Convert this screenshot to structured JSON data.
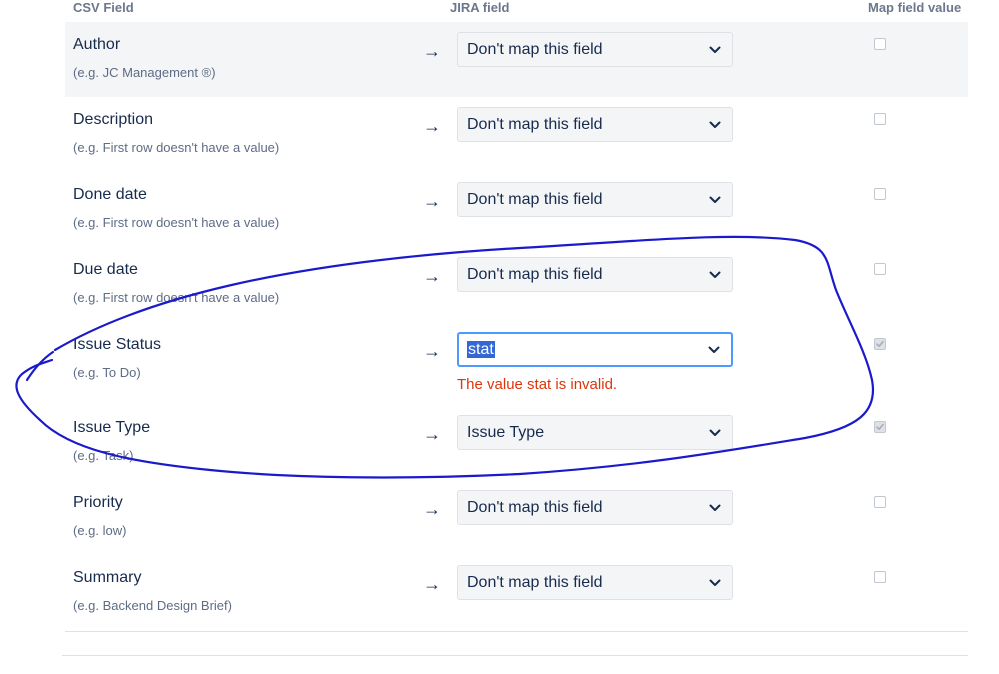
{
  "header": {
    "csv_field": "CSV Field",
    "jira_field": "JIRA field",
    "map_field_value": "Map field value"
  },
  "arrow_symbol": "→",
  "rows": [
    {
      "name": "Author",
      "example": "(e.g. JC Management ®)",
      "mapping": "Don't map this field",
      "map_value_checked": false
    },
    {
      "name": "Description",
      "example": "(e.g. First row doesn't have a value)",
      "mapping": "Don't map this field",
      "map_value_checked": false
    },
    {
      "name": "Done date",
      "example": "(e.g. First row doesn't have a value)",
      "mapping": "Don't map this field",
      "map_value_checked": false
    },
    {
      "name": "Due date",
      "example": "(e.g. First row doesn't have a value)",
      "mapping": "Don't map this field",
      "map_value_checked": false
    },
    {
      "name": "Issue Status",
      "example": "(e.g. To Do)",
      "mapping": "stat",
      "map_value_checked": true,
      "error": "The value stat is invalid."
    },
    {
      "name": "Issue Type",
      "example": "(e.g. Task)",
      "mapping": "Issue Type",
      "map_value_checked": true
    },
    {
      "name": "Priority",
      "example": "(e.g. low)",
      "mapping": "Don't map this field",
      "map_value_checked": false
    },
    {
      "name": "Summary",
      "example": "(e.g. Backend Design Brief)",
      "mapping": "Don't map this field",
      "map_value_checked": false
    }
  ],
  "colors": {
    "error": "#de350b",
    "focus_border": "#4c9aff",
    "selection_highlight": "#3367d6",
    "annotation_ink": "#1a1acc"
  },
  "icons": {
    "dropdown": "chevron-down-icon",
    "checkbox_mark": "checkmark-icon"
  }
}
